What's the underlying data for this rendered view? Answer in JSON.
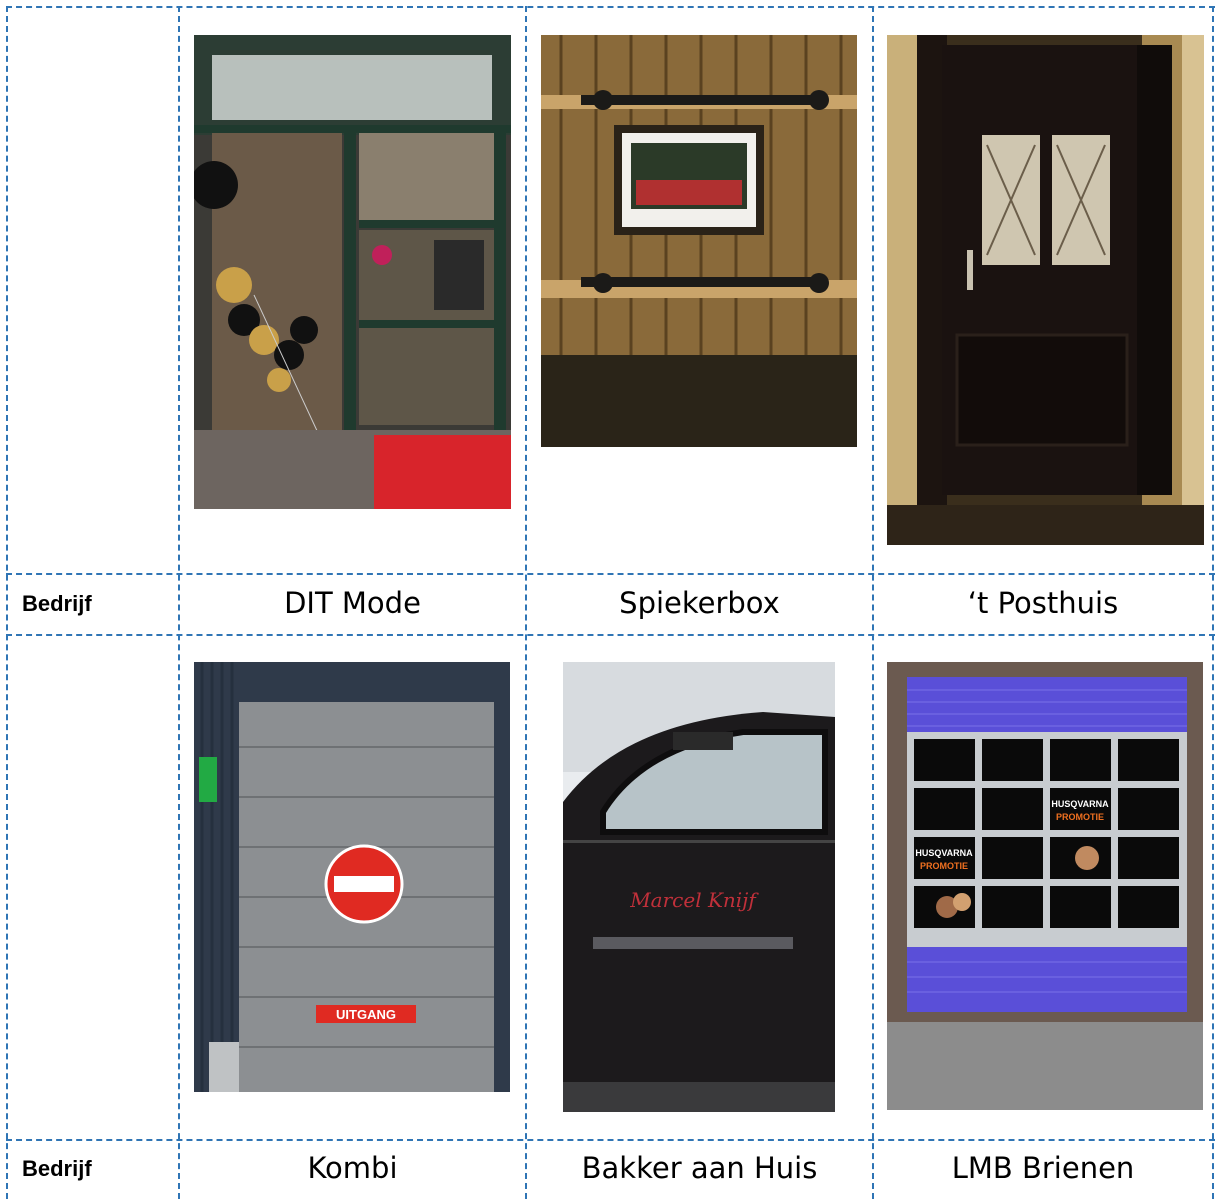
{
  "table": {
    "rows": [
      {
        "label": "Bedrijf",
        "companies": [
          "DIT Mode",
          "Spiekerbox",
          "‘t Posthuis"
        ]
      },
      {
        "label": "Bedrijf",
        "companies": [
          "Kombi",
          "Bakker aan Huis",
          "LMB Brienen"
        ]
      }
    ]
  },
  "photos": {
    "kombi_sign_text": "UITGANG",
    "lmb_poster_1": "HUSQVARNA",
    "lmb_poster_1b": "PROMOTIE",
    "lmb_poster_2": "HUSQVARNA",
    "lmb_poster_2b": "PROMOTIE",
    "bakker_van_text": "Marcel Knijf"
  },
  "colors": {
    "border": "#2f75b5"
  }
}
